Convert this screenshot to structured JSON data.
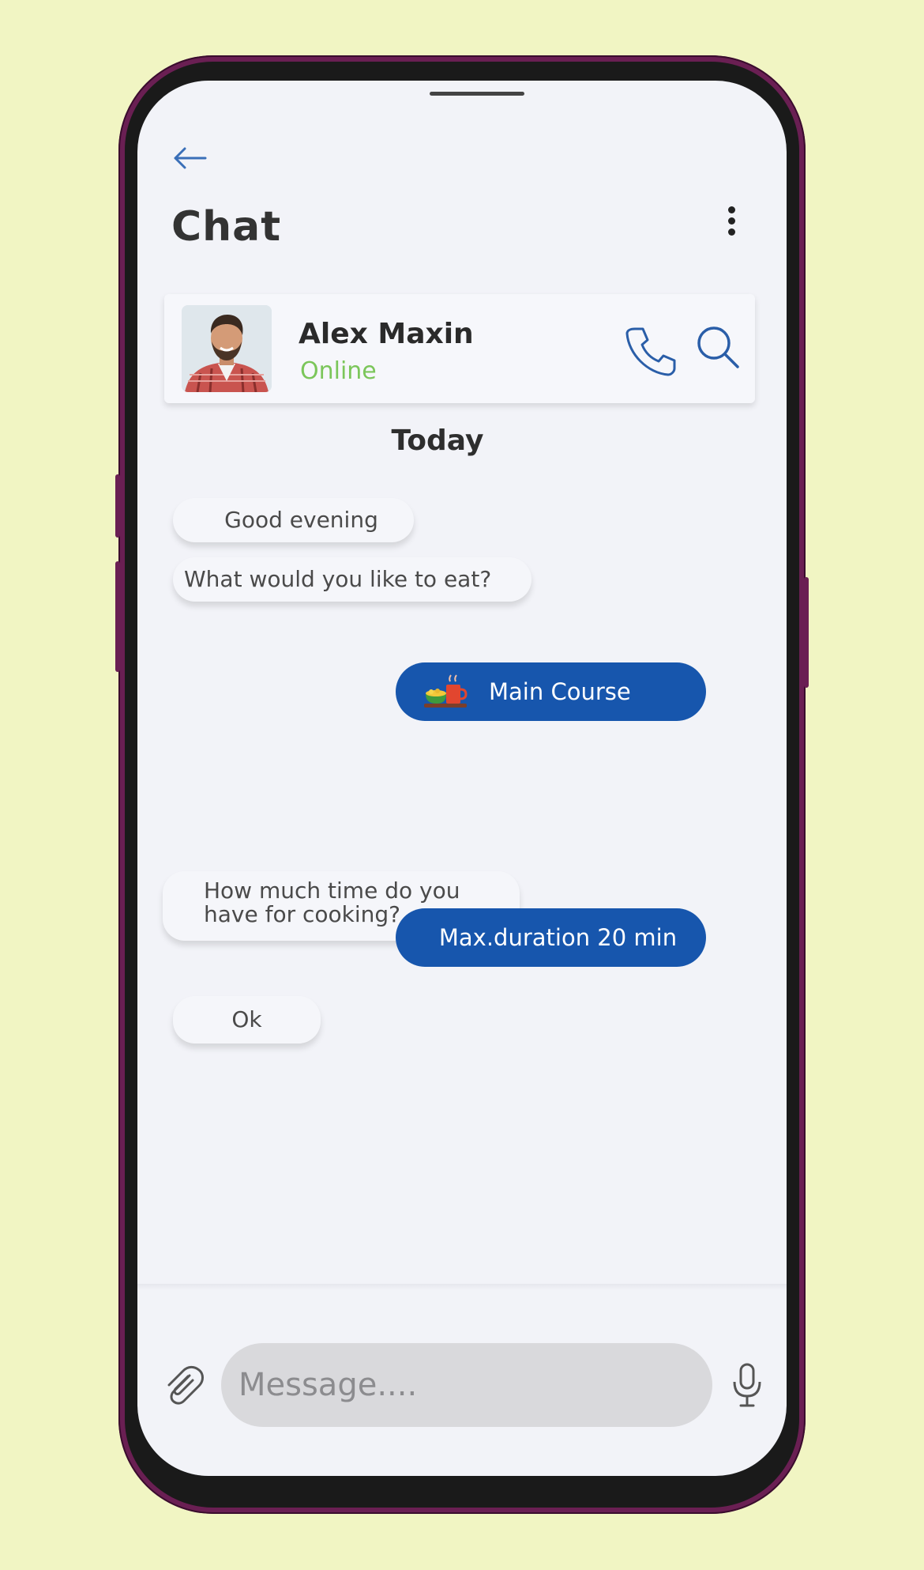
{
  "header": {
    "title": "Chat",
    "back_icon": "arrow-left-icon",
    "more_icon": "vertical-dots-icon"
  },
  "contact": {
    "name": "Alex Maxin",
    "status": "Online",
    "status_color": "#7bc65a",
    "call_icon": "phone-icon",
    "search_icon": "search-icon"
  },
  "conversation": {
    "day_label": "Today",
    "messages": [
      {
        "from": "them",
        "text": "Good evening"
      },
      {
        "from": "them",
        "text": "What would you like to eat?"
      },
      {
        "from": "me",
        "text": "Main Course",
        "icon": "food-tray-icon"
      },
      {
        "from": "them",
        "text": "How much time do you have for cooking?"
      },
      {
        "from": "me",
        "text": "Max.duration 20 min"
      },
      {
        "from": "them",
        "text": "Ok"
      }
    ]
  },
  "composer": {
    "placeholder": "Message....",
    "attach_icon": "paperclip-icon",
    "mic_icon": "microphone-icon"
  },
  "colors": {
    "accent": "#1756ad",
    "background": "#f1f5c3",
    "screen": "#f2f3f8"
  }
}
